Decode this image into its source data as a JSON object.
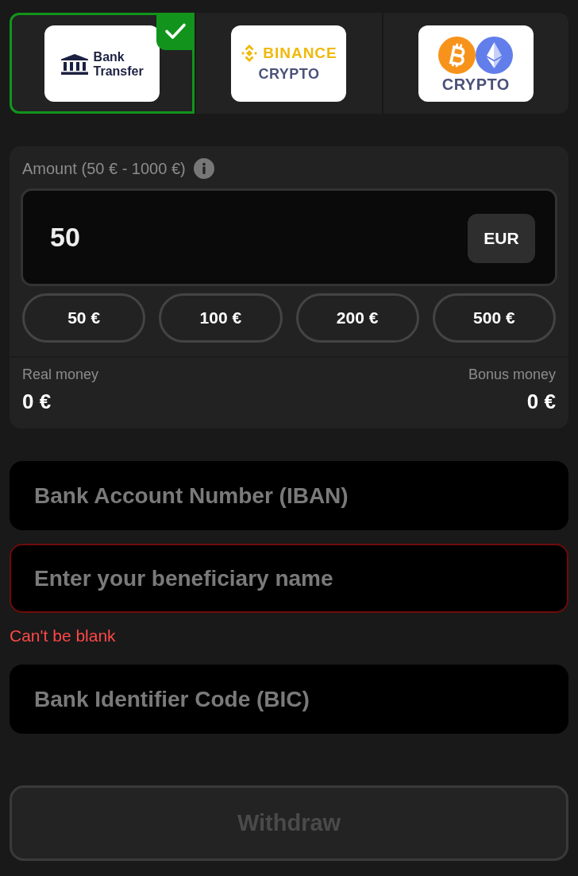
{
  "payment_methods": [
    {
      "kind": "bank",
      "logo_lines": [
        "Bank",
        "Transfer"
      ],
      "selected": true
    },
    {
      "kind": "binance",
      "logo_lines": [
        "BINANCE",
        "CRYPTO"
      ],
      "selected": false
    },
    {
      "kind": "crypto",
      "logo_lines": [
        "CRYPTO"
      ],
      "selected": false
    }
  ],
  "amount": {
    "label": "Amount (50 € - 1000 €)",
    "value": "50",
    "currency": "EUR",
    "presets": [
      "50 €",
      "100 €",
      "200 €",
      "500 €"
    ]
  },
  "balances": [
    {
      "label": "Real money",
      "value": "0 €"
    },
    {
      "label": "Bonus money",
      "value": "0 €"
    }
  ],
  "fields": [
    {
      "placeholder": "Bank Account Number (IBAN)",
      "invalid": false
    },
    {
      "placeholder": "Enter your beneficiary name",
      "invalid": true,
      "error": "Can't be blank"
    },
    {
      "placeholder": "Bank Identifier Code (BIC)",
      "invalid": false
    }
  ],
  "submit": {
    "label": "Withdraw",
    "disabled": true
  }
}
